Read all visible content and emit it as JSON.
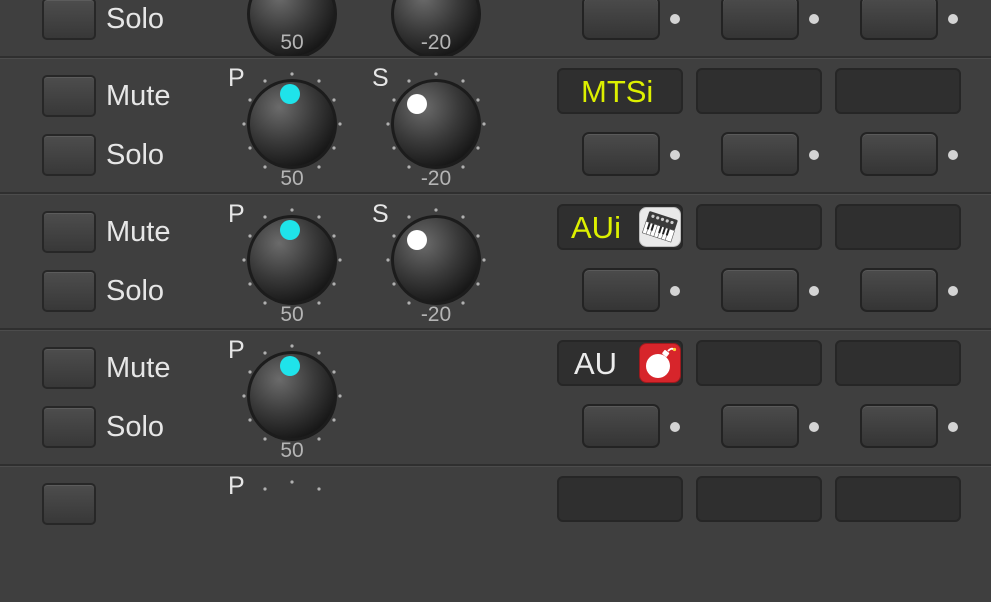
{
  "labels": {
    "mute": "Mute",
    "solo": "Solo",
    "pan_letter": "P",
    "send_letter": "S"
  },
  "knob_colors": {
    "pan_indicator": "#1fe3ea",
    "send_indicator": "#ffffff",
    "value_text": "#b5b5b5"
  },
  "strips": [
    {
      "pan": {
        "value": "50"
      },
      "send": {
        "value": "-20"
      }
    },
    {
      "pan": {
        "value": "50"
      },
      "send": {
        "value": "-20"
      },
      "slot": {
        "label": "MTSi",
        "label_color": "#ddf000",
        "icon": null
      }
    },
    {
      "pan": {
        "value": "50"
      },
      "send": {
        "value": "-20"
      },
      "slot": {
        "label": "AUi",
        "label_color": "#ddf000",
        "icon": "synth-keyboard-icon"
      }
    },
    {
      "pan": {
        "value": "50"
      },
      "slot": {
        "label": "AU",
        "label_color": "#ececec",
        "icon": "red-bomb-icon"
      }
    },
    {
      "pan": {
        "letter": "P"
      }
    }
  ]
}
